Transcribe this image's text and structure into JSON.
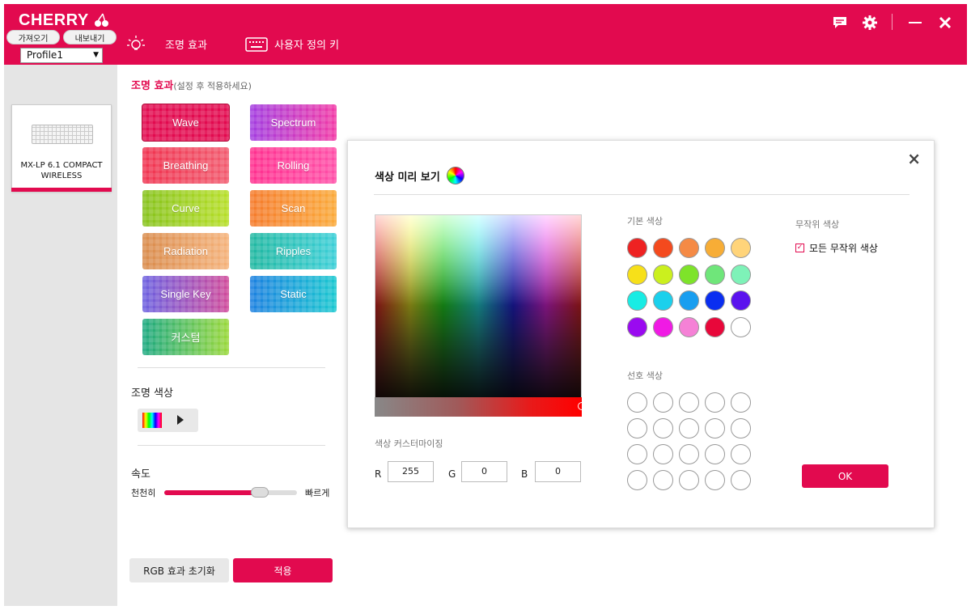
{
  "app": {
    "brand": "CHERRY",
    "import_label": "가져오기",
    "export_label": "내보내기",
    "profile_selected": "Profile1"
  },
  "nav": {
    "lighting_label": "조명 효과",
    "custom_key_label": "사용자 정의 키"
  },
  "device": {
    "name_line1": "MX-LP 6.1 COMPACT",
    "name_line2": "WIRELESS"
  },
  "lighting": {
    "title": "조명 효과",
    "subtitle": "(설정 후 적용하세요)",
    "effects": [
      {
        "label": "Wave",
        "gradient": "#e20a4f"
      },
      {
        "label": "Spectrum",
        "gradient": "#a23be0,#f23aa6"
      },
      {
        "label": "Breathing",
        "gradient": "#f0324f,#f25a6e"
      },
      {
        "label": "Rolling",
        "gradient": "#ff2e8e,#ff4fa8"
      },
      {
        "label": "Curve",
        "gradient": "#86c21b,#b7df28"
      },
      {
        "label": "Scan",
        "gradient": "#f57a2a,#fbaa3a"
      },
      {
        "label": "Radiation",
        "gradient": "#d98a4a,#f5b27a"
      },
      {
        "label": "Ripples",
        "gradient": "#1fb7a0,#3ccfd8"
      },
      {
        "label": "Single Key",
        "gradient": "#6a5fe0,#d04a9a"
      },
      {
        "label": "Static",
        "gradient": "#1a7fe0,#1ac8d0"
      },
      {
        "label": "커스텀",
        "gradient": "#1aa880,#9ad83a"
      }
    ]
  },
  "color_section": {
    "title": "조명 색상"
  },
  "speed": {
    "title": "속도",
    "slow_label": "천천히",
    "fast_label": "빠르게",
    "value_fraction": 0.72
  },
  "actions": {
    "reset_label": "RGB 효과 초기화",
    "apply_label": "적용"
  },
  "modal": {
    "title": "색상 미리 보기",
    "close": "×",
    "basic_colors_label": "기본 색상",
    "favorite_colors_label": "선호 색상",
    "random_label": "무작위 색상",
    "random_all_label": "모든 무작위 색상",
    "random_all_checked": true,
    "customize_label": "색상 커스터마이징",
    "r_label": "R",
    "g_label": "G",
    "b_label": "B",
    "r_value": "255",
    "g_value": "0",
    "b_value": "0",
    "ok_label": "OK",
    "basic_colors": [
      "#ee2222",
      "#f44a1e",
      "#f58a45",
      "#f7ad36",
      "#ffd47a",
      "#f7e019",
      "#cbf01e",
      "#7ee32a",
      "#6fe67a",
      "#7ef2b8",
      "#19ece4",
      "#1bd0ec",
      "#199ef0",
      "#0a2ef0",
      "#5a12ee",
      "#9a0af0",
      "#f01ae4",
      "#f581d6",
      "#e8073a",
      "#ffffff"
    ]
  }
}
